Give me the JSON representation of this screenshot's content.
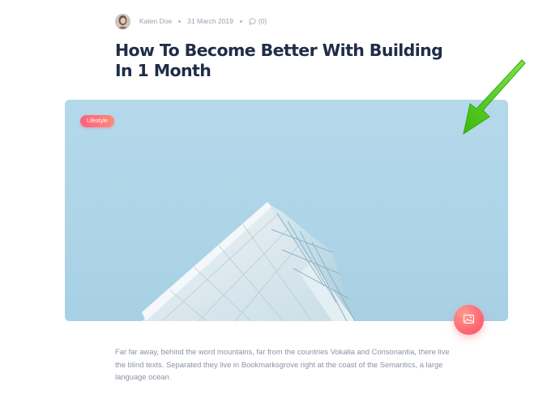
{
  "post": {
    "author": "Katen Doe",
    "date": "31 March 2019",
    "comments": "(0)",
    "title": "How To Become Better With Building In 1 Month",
    "category": "Lifestyle",
    "excerpt": "Far far away, behind the word mountains, far from the countries Vokalia and Consonantia, there live the blind texts. Separated they live in Bookmarksgrove right at the coast of the Semantics, a large language ocean."
  },
  "icons": {
    "avatar": "author-avatar",
    "comment": "comment-bubble-icon",
    "format": "image-icon",
    "annotation": "green-arrow-icon"
  },
  "colors": {
    "title": "#1f2d47",
    "muted_text": "#9aa0b0",
    "accent": "#ff6070",
    "sky": "#aed3e5",
    "annotation": "#5ed01c"
  }
}
